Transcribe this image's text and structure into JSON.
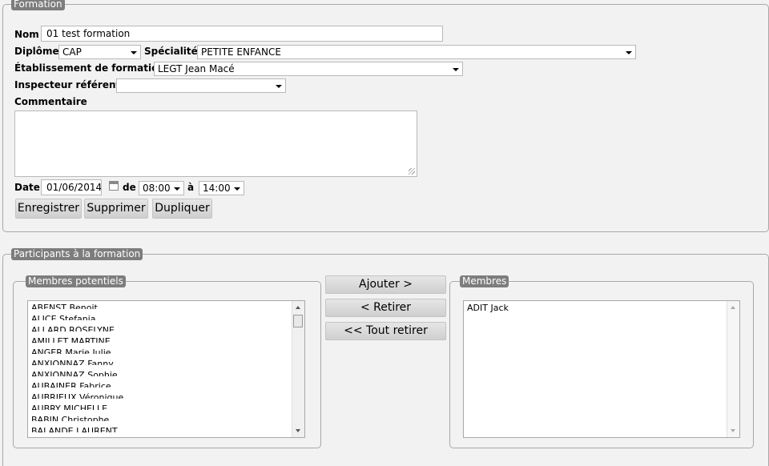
{
  "formation": {
    "legend": "Formation",
    "nom_label": "Nom",
    "nom_value": "01 test formation",
    "diplome_label": "Diplôme",
    "diplome_value": "CAP",
    "specialite_label": "Spécialité",
    "specialite_value": "PETITE ENFANCE",
    "etablissement_label": "Établissement de formation",
    "etablissement_value": "LEGT Jean Macé",
    "inspecteur_label": "Inspecteur référent",
    "inspecteur_value": "",
    "commentaire_label": "Commentaire",
    "commentaire_value": "",
    "date_label": "Date",
    "date_value": "01/06/2014",
    "de_label": "de",
    "de_value": "08:00",
    "a_label": "à",
    "a_value": "14:00",
    "buttons": {
      "enregistrer": "Enregistrer",
      "supprimer": "Supprimer",
      "dupliquer": "Dupliquer"
    }
  },
  "participants": {
    "legend": "Participants à la formation",
    "potentiels_legend": "Membres potentiels",
    "potentiels": [
      "ABENST Benoit",
      "ALICE Stefania",
      "ALLARD ROSELYNE",
      "AMILLET MARTINE",
      "ANGER Marie Julie",
      "ANXIONNAZ Fanny",
      "ANXIONNAZ Sophie",
      "AUBAINER Fabrice",
      "AUBRIEUX Véronique",
      "AUBRY MICHELLE",
      "BABIN Christophe",
      "BALANDE LAURENT"
    ],
    "buttons": {
      "ajouter": "Ajouter >",
      "retirer": "< Retirer",
      "tout_retirer": "<< Tout retirer"
    },
    "membres_legend": "Membres",
    "membres": [
      "ADIT Jack"
    ]
  }
}
